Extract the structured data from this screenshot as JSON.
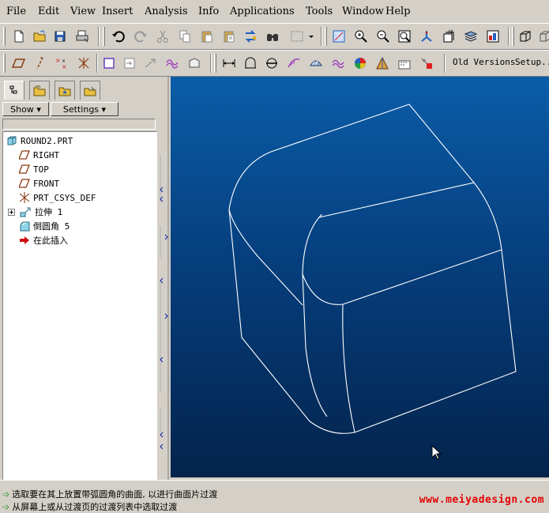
{
  "menu": [
    "File",
    "Edit",
    "View",
    "Insert",
    "Analysis",
    "Info",
    "Applications",
    "Tools",
    "Window",
    "Help"
  ],
  "toolbar": {
    "old_versions": "Old Versions",
    "setup": "Setup.."
  },
  "panel": {
    "show_label": "Show ▾",
    "settings_label": "Settings ▾"
  },
  "tree": [
    {
      "label": "ROUND2.PRT",
      "icon": "part-icon"
    },
    {
      "label": "RIGHT",
      "icon": "datum-plane-icon"
    },
    {
      "label": "TOP",
      "icon": "datum-plane-icon"
    },
    {
      "label": "FRONT",
      "icon": "datum-plane-icon"
    },
    {
      "label": "PRT_CSYS_DEF",
      "icon": "csys-icon"
    },
    {
      "label": "拉伸 1",
      "icon": "extrude-icon"
    },
    {
      "label": "倒圆角 5",
      "icon": "round-icon"
    },
    {
      "label": "在此插入",
      "icon": "insert-here-icon"
    }
  ],
  "status": [
    "选取要在其上放置带弧圆角的曲面, 以进行曲面片过渡",
    "从屏幕上或从过渡页的过渡列表中选取过渡"
  ],
  "watermark": "www.meiyadesign.com",
  "colors": {
    "viewport_top": "#0a5da8",
    "viewport_bottom": "#03234c",
    "wireframe": "#ffffff",
    "watermark": "#e60000"
  }
}
